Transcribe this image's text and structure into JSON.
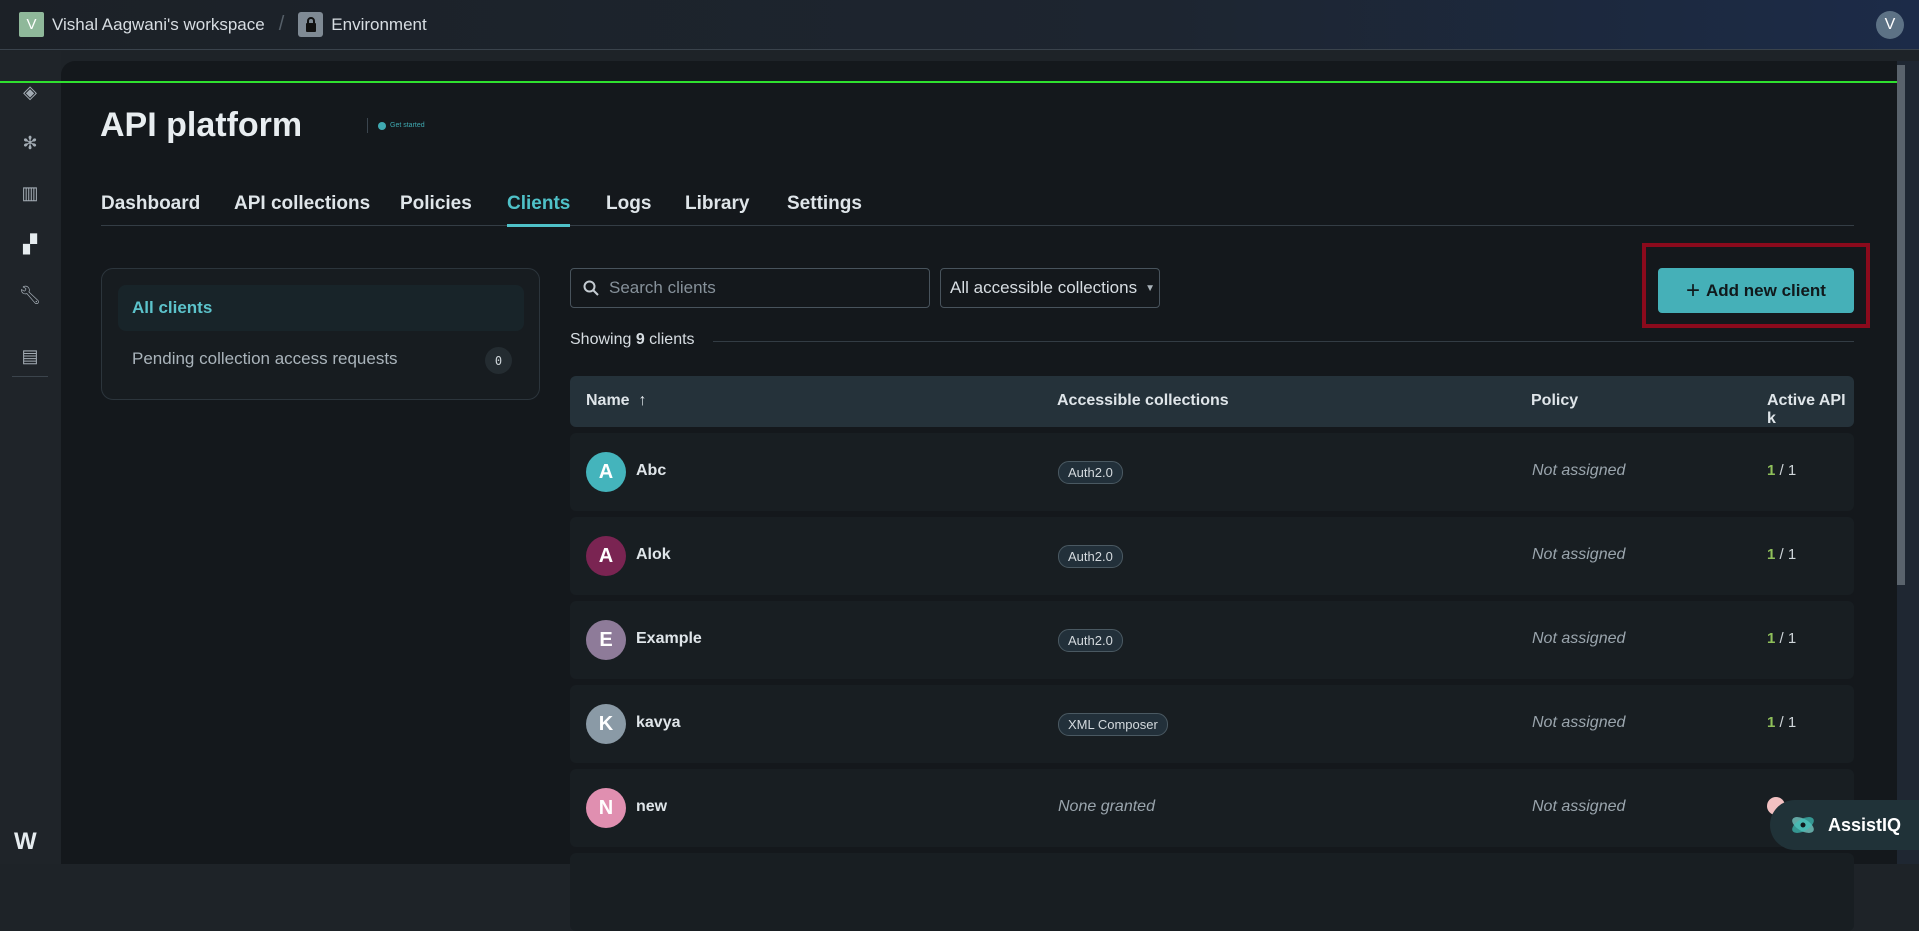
{
  "topbar": {
    "workspace_initial": "V",
    "workspace_name": "Vishal Aagwani's workspace",
    "separator": "/",
    "environment": "Environment",
    "user_initial": "V"
  },
  "rail": {
    "icons": [
      "layers-icon",
      "snowflake-icon",
      "book-icon",
      "dashboard-icon",
      "wrench-icon",
      "server-security-icon"
    ],
    "logo": "W"
  },
  "page": {
    "title": "API platform",
    "get_started": "Get started"
  },
  "tabs": [
    {
      "label": "Dashboard"
    },
    {
      "label": "API collections"
    },
    {
      "label": "Policies"
    },
    {
      "label": "Clients",
      "active": true
    },
    {
      "label": "Logs"
    },
    {
      "label": "Library"
    },
    {
      "label": "Settings"
    }
  ],
  "left_nav": {
    "all_clients": "All clients",
    "pending": "Pending collection access requests",
    "pending_count": "0"
  },
  "toolbar": {
    "search_placeholder": "Search clients",
    "collection_filter": "All accessible collections",
    "add_button": "Add new client",
    "add_icon": "+"
  },
  "showing": {
    "prefix": "Showing ",
    "count": "9",
    "suffix": " clients"
  },
  "table": {
    "columns": [
      "Name",
      "Accessible collections",
      "Policy",
      "Active API k"
    ],
    "sort_icon": "↑",
    "rows": [
      {
        "initial": "A",
        "name": "Abc",
        "color": "#44b4bc",
        "collection": "Auth2.0",
        "policy": "Not assigned",
        "active": "1",
        "total": "1"
      },
      {
        "initial": "A",
        "name": "Alok",
        "color": "#7a2452",
        "collection": "Auth2.0",
        "policy": "Not assigned",
        "active": "1",
        "total": "1"
      },
      {
        "initial": "E",
        "name": "Example",
        "color": "#8e7b99",
        "collection": "Auth2.0",
        "policy": "Not assigned",
        "active": "1",
        "total": "1"
      },
      {
        "initial": "K",
        "name": "kavya",
        "color": "#8a9aa6",
        "collection": "XML Composer",
        "policy": "Not assigned",
        "active": "1",
        "total": "1"
      },
      {
        "initial": "N",
        "name": "new",
        "color": "#e08fb0",
        "collection_none": "None granted",
        "policy": "Not assigned"
      }
    ]
  },
  "assist": {
    "label": "AssistIQ"
  },
  "colors": {
    "accent": "#45b0b8",
    "highlight_box": "#8b0a1c",
    "active_keys": "#8fc05a"
  }
}
